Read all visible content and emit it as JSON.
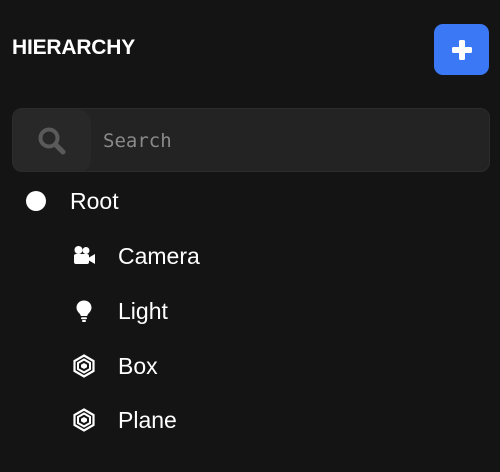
{
  "header": {
    "title": "HIERARCHY",
    "add_button_icon": "plus-icon",
    "accent_color": "#3b78f5"
  },
  "search": {
    "placeholder": "Search",
    "value": "",
    "icon": "search-icon"
  },
  "tree": {
    "root": {
      "label": "Root",
      "icon": "circle-dot-icon"
    },
    "children": [
      {
        "label": "Camera",
        "icon": "video-camera-icon"
      },
      {
        "label": "Light",
        "icon": "lightbulb-icon"
      },
      {
        "label": "Box",
        "icon": "hexagon-mesh-icon"
      },
      {
        "label": "Plane",
        "icon": "hexagon-mesh-icon"
      }
    ]
  }
}
